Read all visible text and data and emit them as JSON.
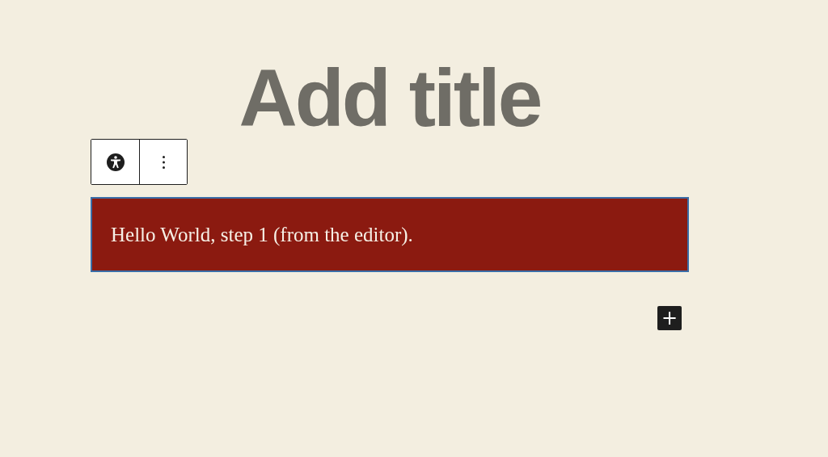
{
  "title": {
    "placeholder": "Add title"
  },
  "block_toolbar": {
    "buttons": [
      {
        "kind": "accessibility"
      },
      {
        "kind": "more"
      }
    ]
  },
  "paragraph_block": {
    "text": "Hello World, step 1 (from the editor).",
    "selected": true
  },
  "add_block_button": {
    "label": "+"
  }
}
